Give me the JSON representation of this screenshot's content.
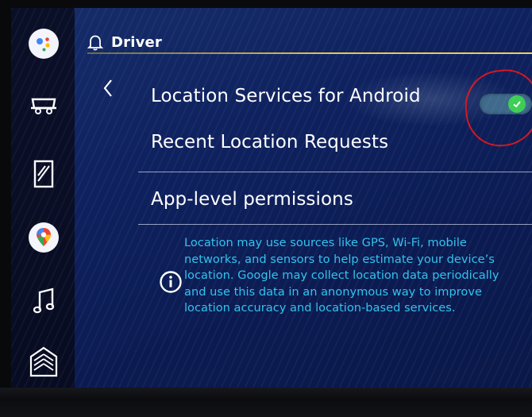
{
  "header": {
    "title": "Driver"
  },
  "settings": {
    "items": [
      {
        "label": "Location Services for Android",
        "toggle_state": "on"
      },
      {
        "label": "Recent Location Requests"
      },
      {
        "label": "App-level permissions"
      }
    ]
  },
  "info": {
    "text": "Location may use sources like GPS, Wi-Fi, mobile networks, and sensors to help estimate your device’s location. Google may collect location data periodically and use this data in an anonymous way to improve location accuracy and location-based services."
  },
  "rail": {
    "items": [
      {
        "icon": "google-assistant-icon"
      },
      {
        "icon": "vehicle-icon"
      },
      {
        "icon": "phone-projection-icon"
      },
      {
        "icon": "maps-icon"
      },
      {
        "icon": "music-note-icon"
      },
      {
        "icon": "apps-home-icon"
      }
    ]
  },
  "colors": {
    "background": "#0f2260",
    "accent_line": "#e9c54a",
    "info_text": "#31c3ec",
    "toggle_on": "#3ccf55",
    "annotation": "#d31620"
  }
}
